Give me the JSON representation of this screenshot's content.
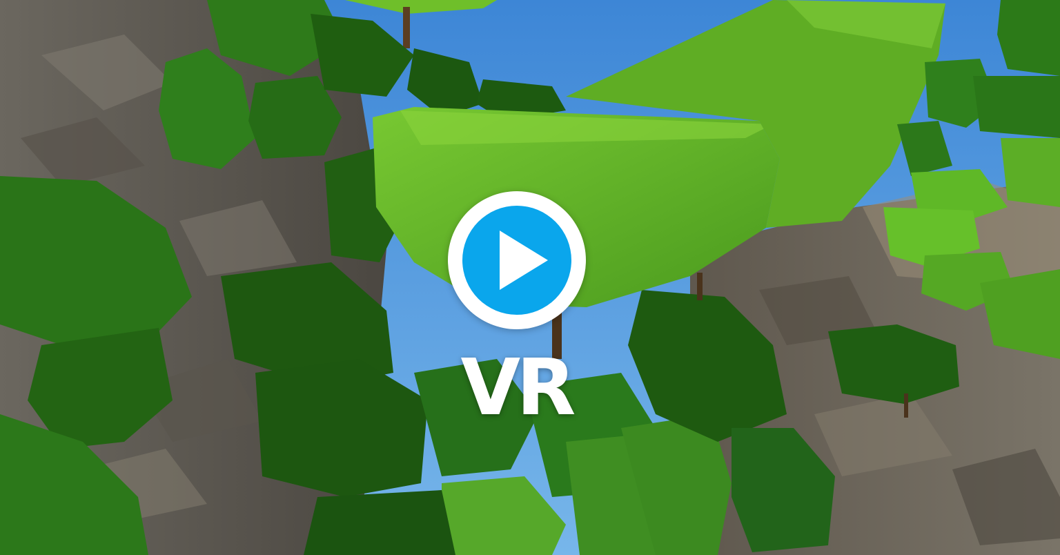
{
  "video": {
    "play_label": "",
    "vr_label": "VR"
  },
  "icons": {
    "play": "play-icon"
  },
  "colors": {
    "play_accent": "#0aa6ec",
    "play_ring": "#ffffff",
    "label": "#ffffff",
    "sky": "#4a8fd4",
    "foliage_light": "#6fbf2a",
    "foliage_dark": "#1f4f10",
    "rock": "#6b655c"
  }
}
